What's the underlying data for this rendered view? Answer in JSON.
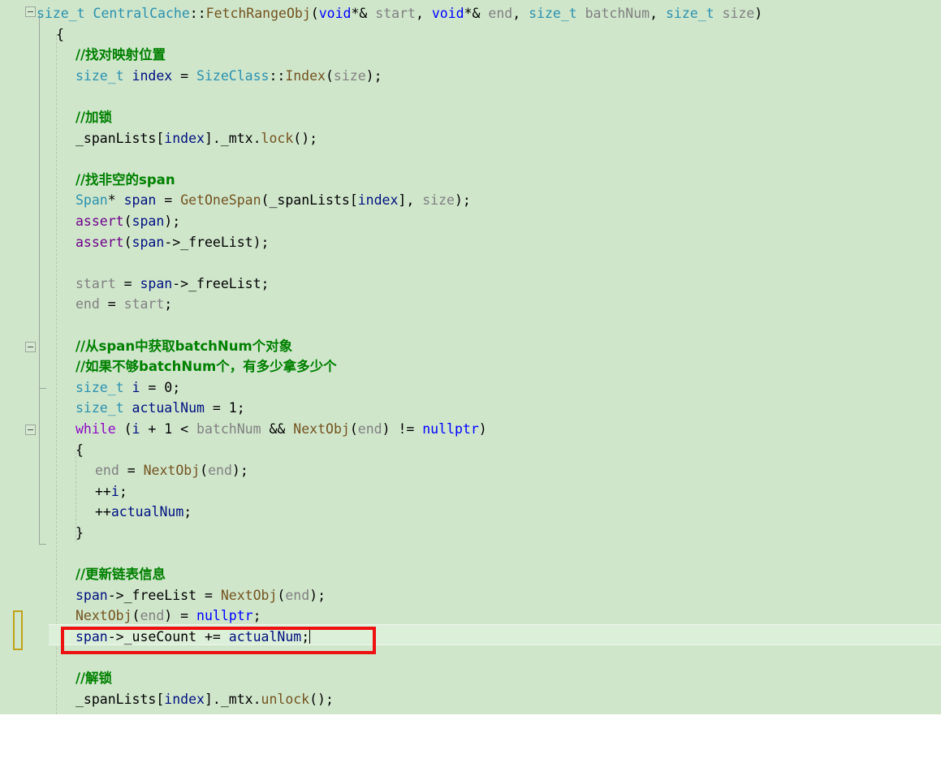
{
  "editor": {
    "language": "cpp",
    "theme_background": "#cfe6cb",
    "current_line_background": "#dcefd8",
    "annotation_color": "#ee1111",
    "unsaved_change_marker_color": "#bfa21a",
    "colors": {
      "comment": "#008000",
      "keyword": "#0000ff",
      "control_keyword": "#8f08c4",
      "type": "#2b91af",
      "function": "#74531f",
      "macro": "#6f008a",
      "local_variable": "#001080",
      "parameter": "#808080",
      "plain_text": "#000000"
    },
    "icons": {
      "fold_collapse": "minus-box",
      "change_marker": "vertical-bar-outline"
    }
  },
  "code": {
    "lines": [
      {
        "indent": 0,
        "tokens": [
          {
            "t": "size_t",
            "c": "ty"
          },
          {
            "t": " ",
            "c": "pl"
          },
          {
            "t": "CentralCache",
            "c": "ty"
          },
          {
            "t": "::",
            "c": "pl"
          },
          {
            "t": "FetchRangeObj",
            "c": "fn"
          },
          {
            "t": "(",
            "c": "pl"
          },
          {
            "t": "void",
            "c": "k"
          },
          {
            "t": "*& ",
            "c": "pl"
          },
          {
            "t": "start",
            "c": "par"
          },
          {
            "t": ", ",
            "c": "pl"
          },
          {
            "t": "void",
            "c": "k"
          },
          {
            "t": "*& ",
            "c": "pl"
          },
          {
            "t": "end",
            "c": "par"
          },
          {
            "t": ", ",
            "c": "pl"
          },
          {
            "t": "size_t",
            "c": "ty"
          },
          {
            "t": " ",
            "c": "pl"
          },
          {
            "t": "batchNum",
            "c": "par"
          },
          {
            "t": ", ",
            "c": "pl"
          },
          {
            "t": "size_t",
            "c": "ty"
          },
          {
            "t": " ",
            "c": "pl"
          },
          {
            "t": "size",
            "c": "par"
          },
          {
            "t": ")",
            "c": "pl"
          }
        ]
      },
      {
        "indent": 1,
        "tokens": [
          {
            "t": "{",
            "c": "pl"
          }
        ]
      },
      {
        "indent": 2,
        "tokens": [
          {
            "t": "//找对映射位置",
            "c": "cm",
            "cjk": true
          }
        ]
      },
      {
        "indent": 2,
        "tokens": [
          {
            "t": "size_t",
            "c": "ty"
          },
          {
            "t": " ",
            "c": "pl"
          },
          {
            "t": "index",
            "c": "var"
          },
          {
            "t": " = ",
            "c": "pl"
          },
          {
            "t": "SizeClass",
            "c": "ty"
          },
          {
            "t": "::",
            "c": "pl"
          },
          {
            "t": "Index",
            "c": "fn"
          },
          {
            "t": "(",
            "c": "pl"
          },
          {
            "t": "size",
            "c": "par"
          },
          {
            "t": ");",
            "c": "pl"
          }
        ]
      },
      {
        "indent": 2,
        "tokens": []
      },
      {
        "indent": 2,
        "tokens": [
          {
            "t": "//加锁",
            "c": "cm",
            "cjk": true
          }
        ]
      },
      {
        "indent": 2,
        "tokens": [
          {
            "t": "_spanLists",
            "c": "pl"
          },
          {
            "t": "[",
            "c": "pl"
          },
          {
            "t": "index",
            "c": "var"
          },
          {
            "t": "].",
            "c": "pl"
          },
          {
            "t": "_mtx",
            "c": "pl"
          },
          {
            "t": ".",
            "c": "pl"
          },
          {
            "t": "lock",
            "c": "fn"
          },
          {
            "t": "();",
            "c": "pl"
          }
        ]
      },
      {
        "indent": 2,
        "tokens": []
      },
      {
        "indent": 2,
        "tokens": [
          {
            "t": "//找非空的span",
            "c": "cm",
            "cjk": true
          }
        ]
      },
      {
        "indent": 2,
        "tokens": [
          {
            "t": "Span",
            "c": "ty"
          },
          {
            "t": "* ",
            "c": "pl"
          },
          {
            "t": "span",
            "c": "var"
          },
          {
            "t": " = ",
            "c": "pl"
          },
          {
            "t": "GetOneSpan",
            "c": "fn"
          },
          {
            "t": "(",
            "c": "pl"
          },
          {
            "t": "_spanLists",
            "c": "pl"
          },
          {
            "t": "[",
            "c": "pl"
          },
          {
            "t": "index",
            "c": "var"
          },
          {
            "t": "], ",
            "c": "pl"
          },
          {
            "t": "size",
            "c": "par"
          },
          {
            "t": ");",
            "c": "pl"
          }
        ]
      },
      {
        "indent": 2,
        "tokens": [
          {
            "t": "assert",
            "c": "mac"
          },
          {
            "t": "(",
            "c": "pl"
          },
          {
            "t": "span",
            "c": "var"
          },
          {
            "t": ");",
            "c": "pl"
          }
        ]
      },
      {
        "indent": 2,
        "tokens": [
          {
            "t": "assert",
            "c": "mac"
          },
          {
            "t": "(",
            "c": "pl"
          },
          {
            "t": "span",
            "c": "var"
          },
          {
            "t": "->",
            "c": "pl"
          },
          {
            "t": "_freeList",
            "c": "pl"
          },
          {
            "t": ");",
            "c": "pl"
          }
        ]
      },
      {
        "indent": 2,
        "tokens": []
      },
      {
        "indent": 2,
        "tokens": [
          {
            "t": "start",
            "c": "par"
          },
          {
            "t": " = ",
            "c": "pl"
          },
          {
            "t": "span",
            "c": "var"
          },
          {
            "t": "->",
            "c": "pl"
          },
          {
            "t": "_freeList",
            "c": "pl"
          },
          {
            "t": ";",
            "c": "pl"
          }
        ]
      },
      {
        "indent": 2,
        "tokens": [
          {
            "t": "end",
            "c": "par"
          },
          {
            "t": " = ",
            "c": "pl"
          },
          {
            "t": "start",
            "c": "par"
          },
          {
            "t": ";",
            "c": "pl"
          }
        ]
      },
      {
        "indent": 2,
        "tokens": []
      },
      {
        "indent": 2,
        "tokens": [
          {
            "t": "//从span中获取batchNum个对象",
            "c": "cm",
            "cjk": true
          }
        ]
      },
      {
        "indent": 2,
        "tokens": [
          {
            "t": "//如果不够batchNum个，有多少拿多少个",
            "c": "cm",
            "cjk": true
          }
        ]
      },
      {
        "indent": 2,
        "tokens": [
          {
            "t": "size_t",
            "c": "ty"
          },
          {
            "t": " ",
            "c": "pl"
          },
          {
            "t": "i",
            "c": "var"
          },
          {
            "t": " = ",
            "c": "pl"
          },
          {
            "t": "0",
            "c": "num"
          },
          {
            "t": ";",
            "c": "pl"
          }
        ]
      },
      {
        "indent": 2,
        "tokens": [
          {
            "t": "size_t",
            "c": "ty"
          },
          {
            "t": " ",
            "c": "pl"
          },
          {
            "t": "actualNum",
            "c": "var"
          },
          {
            "t": " = ",
            "c": "pl"
          },
          {
            "t": "1",
            "c": "num"
          },
          {
            "t": ";",
            "c": "pl"
          }
        ]
      },
      {
        "indent": 2,
        "tokens": [
          {
            "t": "while",
            "c": "kc"
          },
          {
            "t": " (",
            "c": "pl"
          },
          {
            "t": "i",
            "c": "var"
          },
          {
            "t": " + ",
            "c": "pl"
          },
          {
            "t": "1",
            "c": "num"
          },
          {
            "t": " < ",
            "c": "pl"
          },
          {
            "t": "batchNum",
            "c": "par"
          },
          {
            "t": " && ",
            "c": "pl"
          },
          {
            "t": "NextObj",
            "c": "fn"
          },
          {
            "t": "(",
            "c": "pl"
          },
          {
            "t": "end",
            "c": "par"
          },
          {
            "t": ") != ",
            "c": "pl"
          },
          {
            "t": "nullptr",
            "c": "k"
          },
          {
            "t": ")",
            "c": "pl"
          }
        ]
      },
      {
        "indent": 2,
        "tokens": [
          {
            "t": "{",
            "c": "pl"
          }
        ]
      },
      {
        "indent": 3,
        "tokens": [
          {
            "t": "end",
            "c": "par"
          },
          {
            "t": " = ",
            "c": "pl"
          },
          {
            "t": "NextObj",
            "c": "fn"
          },
          {
            "t": "(",
            "c": "pl"
          },
          {
            "t": "end",
            "c": "par"
          },
          {
            "t": ");",
            "c": "pl"
          }
        ]
      },
      {
        "indent": 3,
        "tokens": [
          {
            "t": "++",
            "c": "pl"
          },
          {
            "t": "i",
            "c": "var"
          },
          {
            "t": ";",
            "c": "pl"
          }
        ]
      },
      {
        "indent": 3,
        "tokens": [
          {
            "t": "++",
            "c": "pl"
          },
          {
            "t": "actualNum",
            "c": "var"
          },
          {
            "t": ";",
            "c": "pl"
          }
        ]
      },
      {
        "indent": 2,
        "tokens": [
          {
            "t": "}",
            "c": "pl"
          }
        ]
      },
      {
        "indent": 2,
        "tokens": []
      },
      {
        "indent": 2,
        "tokens": [
          {
            "t": "//更新链表信息",
            "c": "cm",
            "cjk": true
          }
        ]
      },
      {
        "indent": 2,
        "tokens": [
          {
            "t": "span",
            "c": "var"
          },
          {
            "t": "->",
            "c": "pl"
          },
          {
            "t": "_freeList",
            "c": "pl"
          },
          {
            "t": " = ",
            "c": "pl"
          },
          {
            "t": "NextObj",
            "c": "fn"
          },
          {
            "t": "(",
            "c": "pl"
          },
          {
            "t": "end",
            "c": "par"
          },
          {
            "t": ");",
            "c": "pl"
          }
        ]
      },
      {
        "indent": 2,
        "tokens": [
          {
            "t": "NextObj",
            "c": "fn"
          },
          {
            "t": "(",
            "c": "pl"
          },
          {
            "t": "end",
            "c": "par"
          },
          {
            "t": ") = ",
            "c": "pl"
          },
          {
            "t": "nullptr",
            "c": "k"
          },
          {
            "t": ";",
            "c": "pl"
          }
        ]
      },
      {
        "indent": 2,
        "current": true,
        "caret": true,
        "tokens": [
          {
            "t": "span",
            "c": "var"
          },
          {
            "t": "->",
            "c": "pl"
          },
          {
            "t": "_useCount",
            "c": "pl"
          },
          {
            "t": " += ",
            "c": "pl"
          },
          {
            "t": "actualNum",
            "c": "var"
          },
          {
            "t": ";",
            "c": "pl"
          }
        ]
      },
      {
        "indent": 2,
        "tokens": []
      },
      {
        "indent": 2,
        "tokens": [
          {
            "t": "//解锁",
            "c": "cm",
            "cjk": true
          }
        ]
      },
      {
        "indent": 2,
        "tokens": [
          {
            "t": "_spanLists",
            "c": "pl"
          },
          {
            "t": "[",
            "c": "pl"
          },
          {
            "t": "index",
            "c": "var"
          },
          {
            "t": "].",
            "c": "pl"
          },
          {
            "t": "_mtx",
            "c": "pl"
          },
          {
            "t": ".",
            "c": "pl"
          },
          {
            "t": "unlock",
            "c": "fn"
          },
          {
            "t": "();",
            "c": "pl"
          }
        ]
      }
    ]
  },
  "annotation": {
    "type": "rectangle-highlight",
    "color": "#ee1111",
    "target_line_text": "span->_useCount += actualNum;"
  },
  "fold_markers": [
    {
      "name": "fold-marker-function",
      "line_index": 0
    },
    {
      "name": "fold-marker-comment-block",
      "line_index": 17
    },
    {
      "name": "fold-marker-while-loop",
      "line_index": 21
    }
  ],
  "change_marker": {
    "name": "unsaved-change-marker",
    "color": "#bfa21a"
  }
}
